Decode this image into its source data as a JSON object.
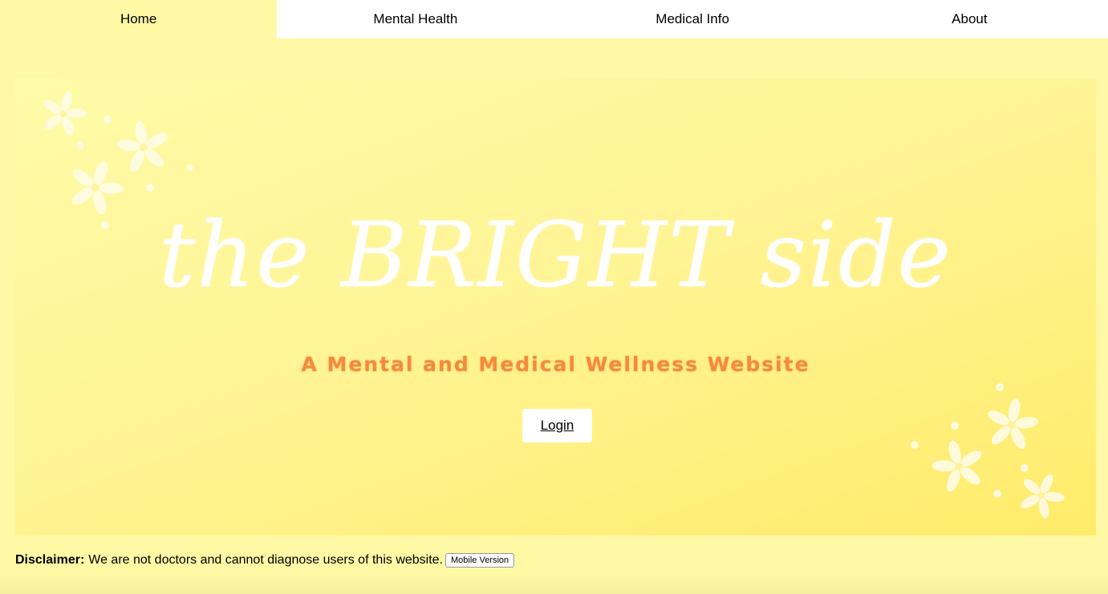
{
  "nav": {
    "items": [
      {
        "label": "Home"
      },
      {
        "label": "Mental Health"
      },
      {
        "label": "Medical Info"
      },
      {
        "label": "About"
      }
    ]
  },
  "hero": {
    "title": "the BRIGHT side",
    "subtitle": "A Mental and Medical Wellness Website",
    "login_label": "Login"
  },
  "footer": {
    "disclaimer_label": "Disclaimer:",
    "disclaimer_text": "We are not doctors and cannot diagnose users of this website.",
    "mobile_button_label": "Mobile Version"
  },
  "colors": {
    "page_background": "#fff9a6",
    "nav_background": "#ffffff",
    "subtitle": "#f58a3c",
    "title": "#ffffff"
  }
}
